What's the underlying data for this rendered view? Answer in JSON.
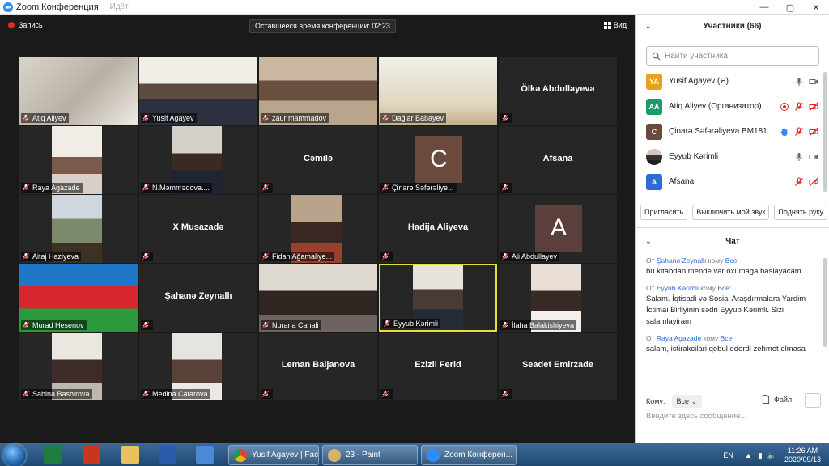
{
  "window": {
    "title": "Zoom Конференция",
    "subtitle": "Идёт"
  },
  "topbar": {
    "record_label": "Запись",
    "timer_text": "Оставшееся время конференции: 02:23",
    "view_label": "Вид"
  },
  "tiles": [
    {
      "name": "Atiq Aliyev",
      "type": "video"
    },
    {
      "name": "Yusif Agayev",
      "type": "video"
    },
    {
      "name": "zaur mammadov",
      "type": "video"
    },
    {
      "name": "Dağlar Babayev",
      "type": "video"
    },
    {
      "name": "",
      "big_name": "Ölkə Abdullayeva",
      "type": "name"
    },
    {
      "name": "Raya Agazade",
      "type": "video"
    },
    {
      "name": "N.Məmmədova....",
      "type": "video"
    },
    {
      "name": "",
      "big_name": "Cəmilə",
      "type": "name"
    },
    {
      "name": "Çinarə Səfərəliye...",
      "type": "avatar",
      "initial": "C"
    },
    {
      "name": "",
      "big_name": "Afsana",
      "type": "name"
    },
    {
      "name": "Aitaj Haziyeva",
      "type": "video"
    },
    {
      "name": "",
      "big_name": "X Musazadə",
      "type": "name"
    },
    {
      "name": "Fidan Ağamaliye...",
      "type": "video"
    },
    {
      "name": "",
      "big_name": "Hadija Aliyeva",
      "type": "name"
    },
    {
      "name": "Ali Abdullayev",
      "type": "avatar",
      "initial": "A"
    },
    {
      "name": "Murad Hesenov",
      "type": "video"
    },
    {
      "name": "",
      "big_name": "Şahanə Zeynallı",
      "type": "name"
    },
    {
      "name": "Nurana Canali",
      "type": "video"
    },
    {
      "name": "Eyyub Kərimli",
      "type": "video",
      "active": true
    },
    {
      "name": "İlaha Balakishiyeva",
      "type": "video"
    },
    {
      "name": "Sabina Bashirova",
      "type": "video"
    },
    {
      "name": "Medina Cafarova",
      "type": "video"
    },
    {
      "name": "",
      "big_name": "Leman Baljanova",
      "type": "name"
    },
    {
      "name": "",
      "big_name": "Ezizli Ferid",
      "type": "name"
    },
    {
      "name": "",
      "big_name": "Seadet Emirzade",
      "type": "name"
    }
  ],
  "participants": {
    "header": "Участники (66)",
    "search_placeholder": "Найти участника",
    "list": [
      {
        "initials": "YA",
        "name": "Yusif Agayev (Я)",
        "color": "#e8a21a"
      },
      {
        "initials": "AA",
        "name": "Atiq Aliyev (Организатор)",
        "color": "#1c9c6a"
      },
      {
        "initials": "C",
        "name": "Çinarə Səfərəliyeva BM181",
        "color": "#6b4a3e"
      },
      {
        "initials": "",
        "name": "Eyyub Kərimli",
        "color": "#777777"
      },
      {
        "initials": "A",
        "name": "Afsana",
        "color": "#2d6bd6"
      }
    ],
    "buttons": [
      "Пригласить",
      "Выключить мой звук",
      "Поднять руку"
    ]
  },
  "chat": {
    "header": "Чат",
    "messages": [
      {
        "from_prefix": "От",
        "from": "Şahanə Zeynallı",
        "to_prefix": "кому",
        "to": "Все:",
        "text": "bu kitabdan mende var oxumaga baslayacam"
      },
      {
        "from_prefix": "От",
        "from": "Eyyub Kərimli",
        "to_prefix": "кому",
        "to": "Все:",
        "text": "Salam. İqtisadi və Sosial Araşdırmalara Yardim İctimai Birliyinin sədri Eyyub Kərimli. Sizi salamlayiram"
      },
      {
        "from_prefix": "От",
        "from": "Raya Agazade",
        "to_prefix": "кому",
        "to": "Все:",
        "text": "salam, istirakcilari qebul ederdi zehmet olmasa"
      }
    ],
    "to_label": "Кому:",
    "to_value": "Все",
    "file_label": "Файл",
    "more_label": "···",
    "input_placeholder": "Введите здесь сообщение..."
  },
  "taskbar": {
    "tasks": [
      "Yusif Agayev | Fac...",
      "23 - Paint",
      "Zoom Конферен..."
    ],
    "lang": "EN",
    "time": "11:26 AM",
    "date": "2020/09/13"
  },
  "colors": {
    "active_speaker": "#e8e03a",
    "muted_red": "#e02828",
    "panel_link": "#2d6bd6"
  }
}
